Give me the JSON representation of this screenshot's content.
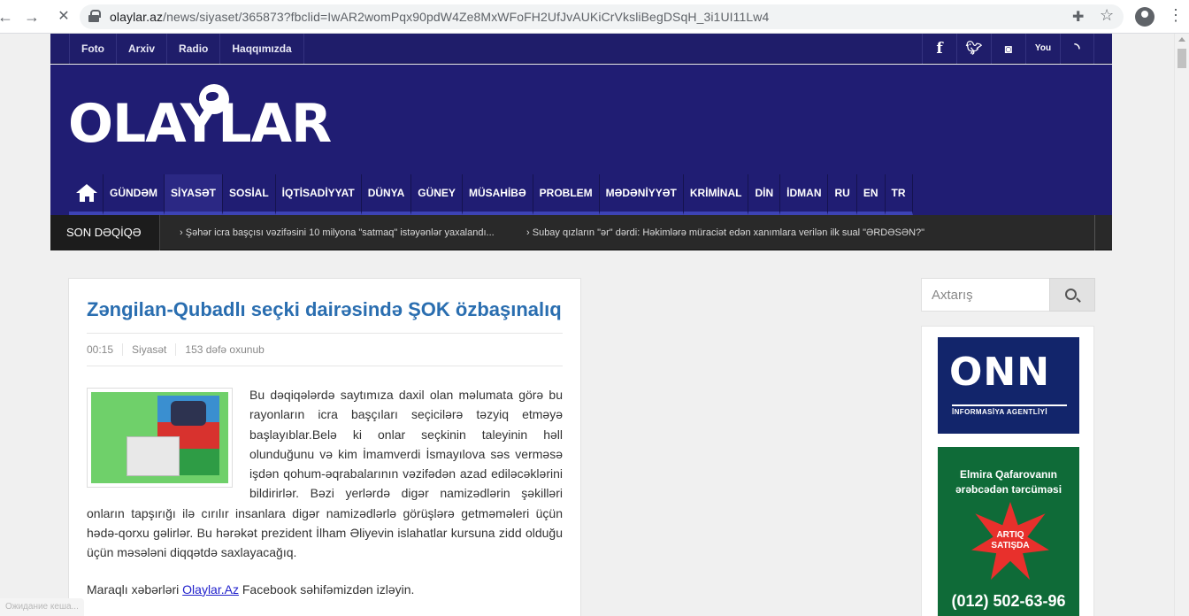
{
  "browser": {
    "url_host": "olaylar.az",
    "url_path": "/news/siyaset/365873?fbclid=IwAR2womPqx90pdW4Ze8MxWFoFH2UfJvAUKiCrVksliBegDSqH_3i1UI11Lw4",
    "status_text": "Ожидание кеша..."
  },
  "topbar": {
    "links": [
      "Foto",
      "Arxiv",
      "Radio",
      "Haqqımızda"
    ],
    "social": [
      "f",
      "t",
      "ig",
      "yt",
      "rss"
    ]
  },
  "logo": {
    "text": "OLAYLAR"
  },
  "nav": {
    "items": [
      "GÜNDƏM",
      "SİYASƏT",
      "SOSİAL",
      "İQTİSADİYYAT",
      "DÜNYA",
      "GÜNEY",
      "MÜSAHİBƏ",
      "PROBLEM",
      "MƏDƏNİYYƏT",
      "KRİMİNAL",
      "DİN",
      "İDMAN",
      "RU",
      "EN",
      "TR"
    ],
    "active": "SİYASƏT"
  },
  "ticker": {
    "label": "SON DƏQİQƏ",
    "news": [
      "Şəhər icra başçısı vəzifəsini 10 milyona \"satmaq\" istəyənlər yaxalandı...",
      "Subay qızların \"ər\" dərdi: Həkimlərə müraciət edən xanımlara verilən ilk sual \"ƏRDƏSƏN?\""
    ]
  },
  "article": {
    "title": "Zəngilan-Qubadlı seçki dairəsində ŞOK özbaşınalıq",
    "time": "00:15",
    "category": "Siyasət",
    "views": "153 dəfə oxunub",
    "body": "Bu dəqiqələrdə saytımıza daxil olan məlumata görə bu rayonların icra başçıları seçicilərə təzyiq etməyə başlayıblar.Belə ki onlar seçkinin taleyinin həll olunduğunu və kim İmamverdi İsmayılova səs verməsə işdən qohum-əqrabalarının vəzifədən azad ediləcəklərini bildirirlər. Bəzi yerlərdə digər namizədlərin şəkilləri onların tapşırığı ilə cırılır insanlara digər namizədlərlə görüşlərə getməməleri üçün hədə-qorxu gəlirlər. Bu hərəkət prezident İlham Əliyevin islahatlar kursuna zidd olduğu üçün məsələni diqqətdə saxlayacağıq.",
    "more_prefix": "Maraqlı xəbərləri ",
    "more_link": "Olaylar.Az",
    "more_suffix": " Facebook səhifəmizdən izləyin."
  },
  "sidebar": {
    "search_placeholder": "Axtarış",
    "ad1": {
      "big": "ONN",
      "small": "İNFORMASİYA AGENTLİYİ"
    },
    "ad2": {
      "line1": "Elmira Qafarovanın",
      "line2": "ərəbcədən tərcüməsi",
      "burst1": "ARTIQ",
      "burst2": "SATIŞDA",
      "phone": "(012) 502-63-96"
    }
  },
  "colors": {
    "brand_navy": "#201d73",
    "title_blue": "#2a6eb0",
    "ticker_bg": "#292929"
  }
}
